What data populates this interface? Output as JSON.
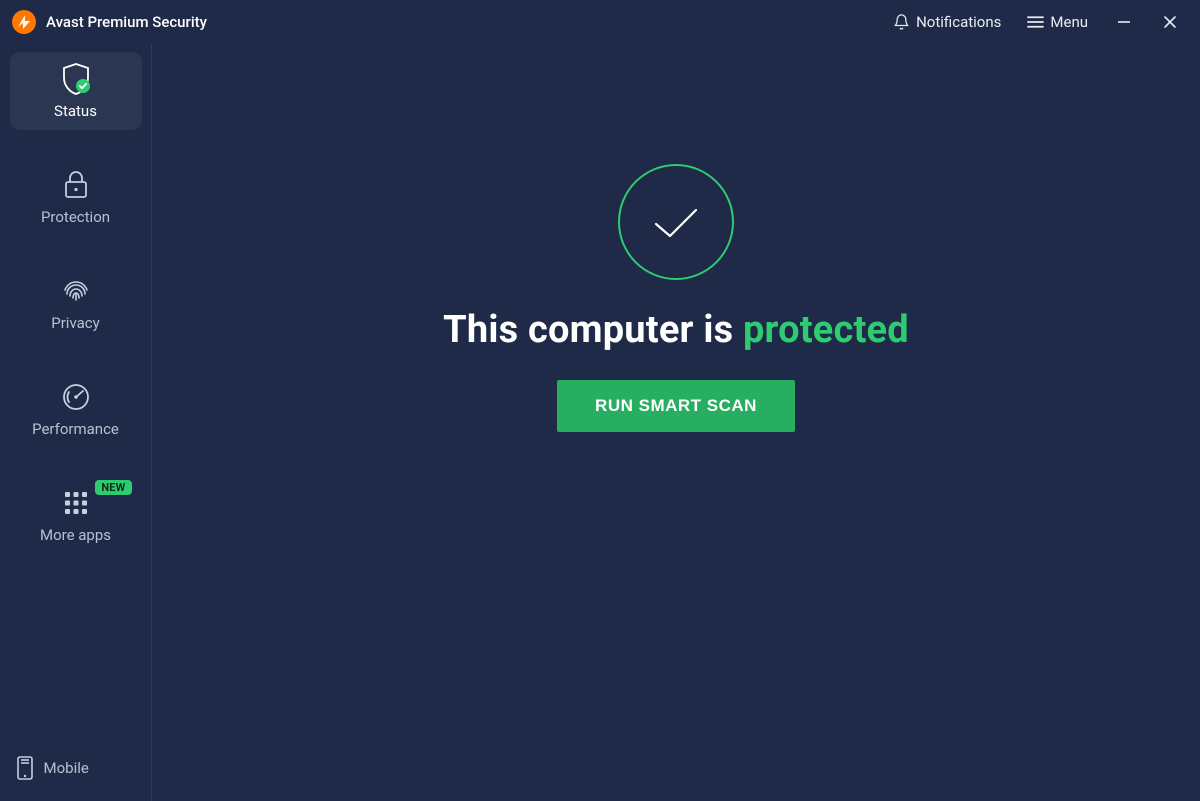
{
  "titlebar": {
    "app_title": "Avast Premium Security",
    "notifications_label": "Notifications",
    "menu_label": "Menu"
  },
  "sidebar": {
    "items": [
      {
        "id": "status",
        "label": "Status",
        "active": true
      },
      {
        "id": "protection",
        "label": "Protection",
        "active": false
      },
      {
        "id": "privacy",
        "label": "Privacy",
        "active": false
      },
      {
        "id": "performance",
        "label": "Performance",
        "active": false
      },
      {
        "id": "more-apps",
        "label": "More apps",
        "active": false,
        "badge": "NEW"
      }
    ],
    "bottom": {
      "label": "Mobile"
    }
  },
  "main": {
    "headline_prefix": "This computer is ",
    "headline_emphasis": "protected",
    "scan_button": "RUN SMART SCAN"
  },
  "colors": {
    "background": "#1e2a47",
    "accent_green": "#27ae60",
    "accent_bright_green": "#2ecc71",
    "brand_orange": "#ff7800"
  }
}
